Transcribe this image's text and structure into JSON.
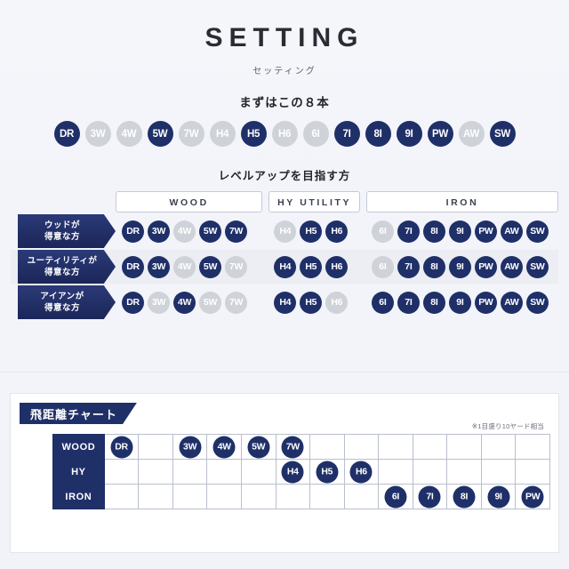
{
  "header": {
    "title": "SETTING",
    "kana": "セッティング",
    "lead": "まずはこの８本"
  },
  "colors": {
    "navy": "#1f2f68",
    "navy_dark": "#1b2658",
    "grey": "#cfd2d8",
    "background": "#f2f4f9"
  },
  "top_row": {
    "clubs": [
      {
        "label": "DR",
        "active": true
      },
      {
        "label": "3W",
        "active": false
      },
      {
        "label": "4W",
        "active": false
      },
      {
        "label": "5W",
        "active": true
      },
      {
        "label": "7W",
        "active": false
      },
      {
        "label": "H4",
        "active": false
      },
      {
        "label": "H5",
        "active": true
      },
      {
        "label": "H6",
        "active": false
      },
      {
        "label": "6I",
        "active": false
      },
      {
        "label": "7I",
        "active": true
      },
      {
        "label": "8I",
        "active": true
      },
      {
        "label": "9I",
        "active": true
      },
      {
        "label": "PW",
        "active": true
      },
      {
        "label": "AW",
        "active": false
      },
      {
        "label": "SW",
        "active": true
      }
    ]
  },
  "matrix": {
    "section_title": "レベルアップを目指す方",
    "columns": [
      {
        "key": "wood",
        "label": "WOOD"
      },
      {
        "key": "hy",
        "label": "HY UTILITY"
      },
      {
        "key": "iron",
        "label": "IRON"
      }
    ],
    "rows": [
      {
        "label_line1": "ウッドが",
        "label_line2": "得意な方",
        "wood": [
          {
            "label": "DR",
            "active": true
          },
          {
            "label": "3W",
            "active": true
          },
          {
            "label": "4W",
            "active": false
          },
          {
            "label": "5W",
            "active": true
          },
          {
            "label": "7W",
            "active": true
          }
        ],
        "hy": [
          {
            "label": "H4",
            "active": false
          },
          {
            "label": "H5",
            "active": true
          },
          {
            "label": "H6",
            "active": true
          }
        ],
        "iron": [
          {
            "label": "6I",
            "active": false
          },
          {
            "label": "7I",
            "active": true
          },
          {
            "label": "8I",
            "active": true
          },
          {
            "label": "9I",
            "active": true
          },
          {
            "label": "PW",
            "active": true
          },
          {
            "label": "AW",
            "active": true
          },
          {
            "label": "SW",
            "active": true
          }
        ]
      },
      {
        "label_line1": "ユーティリティが",
        "label_line2": "得意な方",
        "wood": [
          {
            "label": "DR",
            "active": true
          },
          {
            "label": "3W",
            "active": true
          },
          {
            "label": "4W",
            "active": false
          },
          {
            "label": "5W",
            "active": true
          },
          {
            "label": "7W",
            "active": false
          }
        ],
        "hy": [
          {
            "label": "H4",
            "active": true
          },
          {
            "label": "H5",
            "active": true
          },
          {
            "label": "H6",
            "active": true
          }
        ],
        "iron": [
          {
            "label": "6I",
            "active": false
          },
          {
            "label": "7I",
            "active": true
          },
          {
            "label": "8I",
            "active": true
          },
          {
            "label": "9I",
            "active": true
          },
          {
            "label": "PW",
            "active": true
          },
          {
            "label": "AW",
            "active": true
          },
          {
            "label": "SW",
            "active": true
          }
        ]
      },
      {
        "label_line1": "アイアンが",
        "label_line2": "得意な方",
        "wood": [
          {
            "label": "DR",
            "active": true
          },
          {
            "label": "3W",
            "active": false
          },
          {
            "label": "4W",
            "active": true
          },
          {
            "label": "5W",
            "active": false
          },
          {
            "label": "7W",
            "active": false
          }
        ],
        "hy": [
          {
            "label": "H4",
            "active": true
          },
          {
            "label": "H5",
            "active": true
          },
          {
            "label": "H6",
            "active": false
          }
        ],
        "iron": [
          {
            "label": "6I",
            "active": true
          },
          {
            "label": "7I",
            "active": true
          },
          {
            "label": "8I",
            "active": true
          },
          {
            "label": "9I",
            "active": true
          },
          {
            "label": "PW",
            "active": true
          },
          {
            "label": "AW",
            "active": true
          },
          {
            "label": "SW",
            "active": true
          }
        ]
      }
    ]
  },
  "distance_chart": {
    "tab_label": "飛距離チャート",
    "note": "※1目盛り10ヤード相当",
    "column_count": 13,
    "rows": [
      {
        "header": "WOOD",
        "marks": [
          {
            "col": 1,
            "label": "DR"
          },
          {
            "col": 3,
            "label": "3W"
          },
          {
            "col": 4,
            "label": "4W"
          },
          {
            "col": 5,
            "label": "5W"
          },
          {
            "col": 6,
            "label": "7W"
          }
        ]
      },
      {
        "header": "HY",
        "marks": [
          {
            "col": 6,
            "label": "H4"
          },
          {
            "col": 7,
            "label": "H5"
          },
          {
            "col": 8,
            "label": "H6"
          }
        ]
      },
      {
        "header": "IRON",
        "marks": [
          {
            "col": 9,
            "label": "6I"
          },
          {
            "col": 10,
            "label": "7I"
          },
          {
            "col": 11,
            "label": "8I"
          },
          {
            "col": 12,
            "label": "9I"
          },
          {
            "col": 13,
            "label": "PW"
          }
        ]
      }
    ]
  },
  "chart_data": {
    "type": "table",
    "title": "飛距離チャート",
    "annotations": [
      "※1目盛り10ヤード相当"
    ],
    "xlabel": "distance (1 cell = 10 yards)",
    "categories": [
      "WOOD",
      "HY",
      "IRON"
    ],
    "grid": true,
    "column_count": 13,
    "series": [
      {
        "name": "WOOD",
        "values": [
          {
            "club": "DR",
            "col": 1
          },
          {
            "club": "3W",
            "col": 3
          },
          {
            "club": "4W",
            "col": 4
          },
          {
            "club": "5W",
            "col": 5
          },
          {
            "club": "7W",
            "col": 6
          }
        ]
      },
      {
        "name": "HY",
        "values": [
          {
            "club": "H4",
            "col": 6
          },
          {
            "club": "H5",
            "col": 7
          },
          {
            "club": "H6",
            "col": 8
          }
        ]
      },
      {
        "name": "IRON",
        "values": [
          {
            "club": "6I",
            "col": 9
          },
          {
            "club": "7I",
            "col": 10
          },
          {
            "club": "8I",
            "col": 11
          },
          {
            "club": "9I",
            "col": 12
          },
          {
            "club": "PW",
            "col": 13
          }
        ]
      }
    ]
  }
}
